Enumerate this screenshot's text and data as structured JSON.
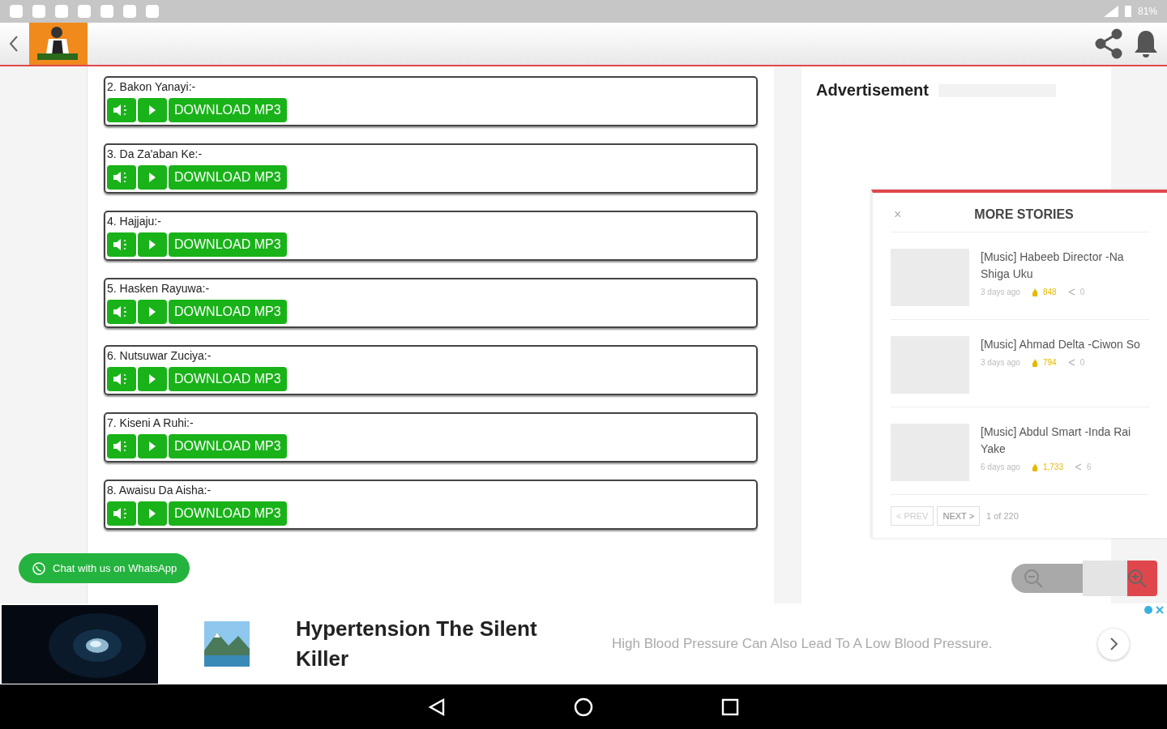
{
  "status_bar": {
    "battery": "81%"
  },
  "songs": [
    {
      "title": "2. Bakon Yanayi:-",
      "download": "DOWNLOAD MP3"
    },
    {
      "title": "3. Da Za'aban Ke:-",
      "download": "DOWNLOAD MP3"
    },
    {
      "title": "4. Hajjaju:-",
      "download": "DOWNLOAD MP3"
    },
    {
      "title": "5. Hasken Rayuwa:-",
      "download": "DOWNLOAD MP3"
    },
    {
      "title": "6. Nutsuwar Zuciya:-",
      "download": "DOWNLOAD MP3"
    },
    {
      "title": "7. Kiseni A Ruhi:-",
      "download": "DOWNLOAD MP3"
    },
    {
      "title": "8. Awaisu Da Aisha:-",
      "download": "DOWNLOAD MP3"
    }
  ],
  "sidebar": {
    "heading": "Advertisement"
  },
  "more_stories": {
    "title": "MORE STORIES",
    "close": "×",
    "stories": [
      {
        "title": "[Music] Habeeb Director -Na Shiga Uku",
        "time": "3 days ago",
        "views": "848",
        "shares": "0"
      },
      {
        "title": "[Music] Ahmad Delta -Ciwon So",
        "time": "3 days ago",
        "views": "794",
        "shares": "0"
      },
      {
        "title": "[Music] Abdul Smart -Inda Rai Yake",
        "time": "6 days ago",
        "views": "1,733",
        "shares": "6"
      }
    ],
    "prev": "< PREV",
    "next": "NEXT >",
    "page": "1 of 220"
  },
  "whatsapp": {
    "label": "Chat with us on WhatsApp"
  },
  "ad": {
    "title": "Hypertension The Silent Killer",
    "text": "High Blood Pressure Can Also Lead To A Low Blood Pressure."
  }
}
